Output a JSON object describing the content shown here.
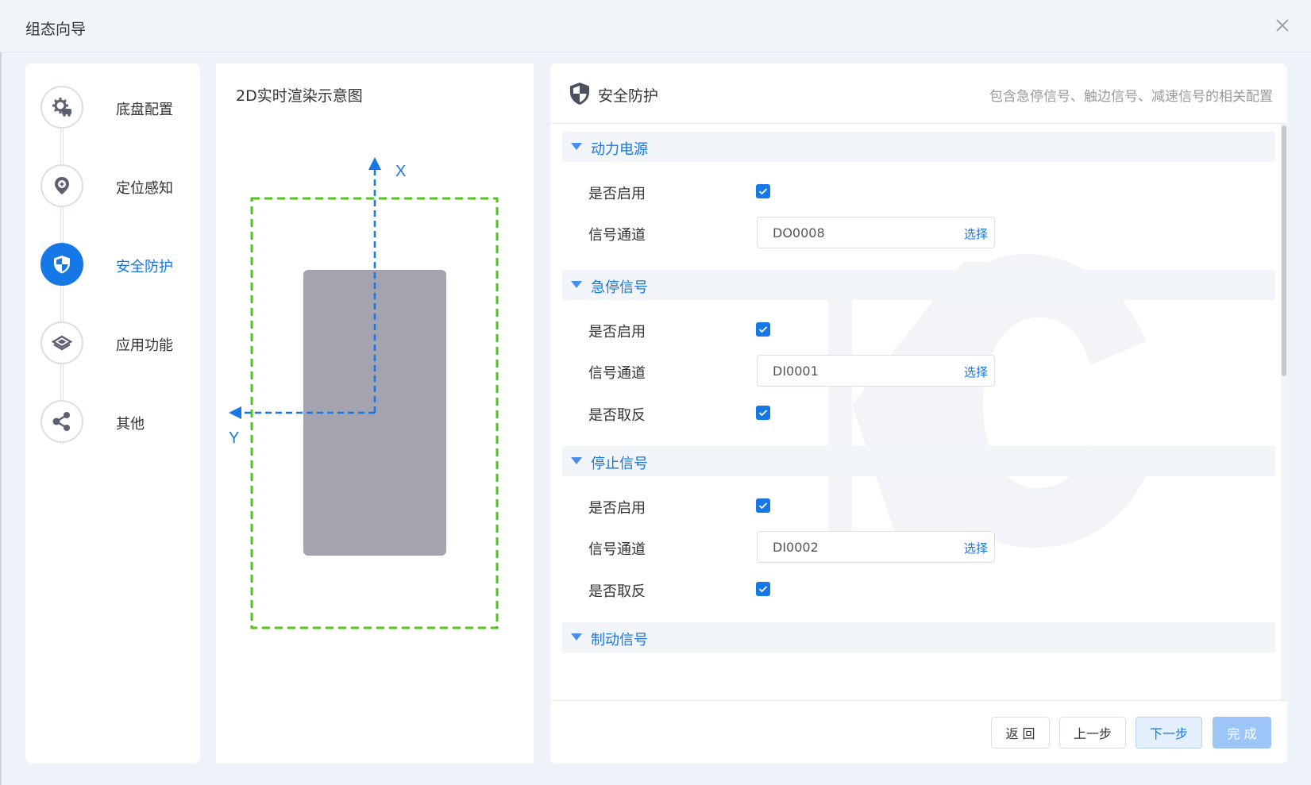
{
  "window": {
    "title": "组态向导"
  },
  "steps": [
    {
      "label": "底盘配置",
      "icon": "gear-car-icon",
      "active": false
    },
    {
      "label": "定位感知",
      "icon": "location-pin-icon",
      "active": false
    },
    {
      "label": "安全防护",
      "icon": "shield-icon",
      "active": true
    },
    {
      "label": "应用功能",
      "icon": "layers-icon",
      "active": false
    },
    {
      "label": "其他",
      "icon": "share-icon",
      "active": false
    }
  ],
  "preview": {
    "title": "2D实时渲染示意图",
    "x_axis_label": "X",
    "y_axis_label": "Y"
  },
  "form": {
    "title": "安全防护",
    "description": "包含急停信号、触边信号、减速信号的相关配置",
    "pick_label": "选择",
    "sections": [
      {
        "title": "动力电源",
        "enable_label": "是否启用",
        "enable_checked": true,
        "channel_label": "信号通道",
        "channel_value": "DO0008"
      },
      {
        "title": "急停信号",
        "enable_label": "是否启用",
        "enable_checked": true,
        "channel_label": "信号通道",
        "channel_value": "DI0001",
        "invert_label": "是否取反",
        "invert_checked": true
      },
      {
        "title": "停止信号",
        "enable_label": "是否启用",
        "enable_checked": true,
        "channel_label": "信号通道",
        "channel_value": "DI0002",
        "invert_label": "是否取反",
        "invert_checked": true
      },
      {
        "title": "制动信号"
      }
    ]
  },
  "footer": {
    "back": "返 回",
    "prev": "上一步",
    "next": "下一步",
    "done": "完 成"
  },
  "colors": {
    "accent": "#1677e6",
    "robot_body": "#a3a4af",
    "safety_zone": "#52c41a"
  }
}
